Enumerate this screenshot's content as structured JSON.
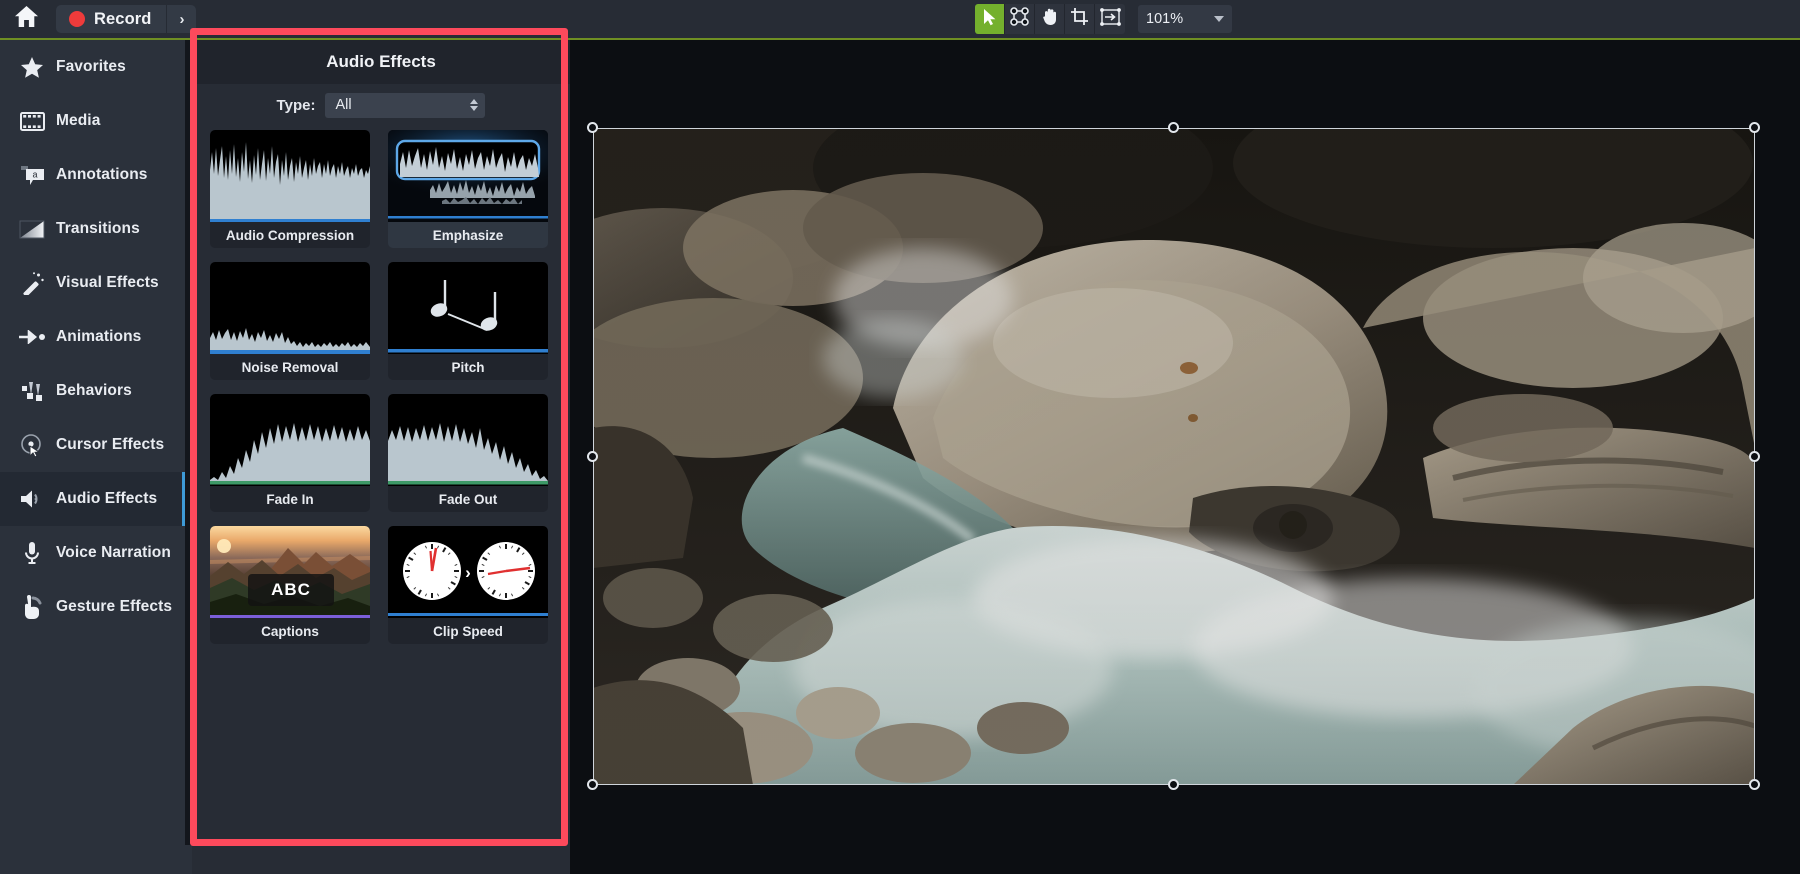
{
  "topbar": {
    "home_icon": "home-icon",
    "record_label": "Record",
    "record_dot_icon": "record-dot-icon",
    "record_more_icon": "chevron-right-icon",
    "tools": [
      {
        "name": "select-tool",
        "icon": "arrow-cursor-icon",
        "active": true
      },
      {
        "name": "node-edit-tool",
        "icon": "node-points-icon",
        "active": false
      },
      {
        "name": "hand-pan-tool",
        "icon": "hand-icon",
        "active": false
      },
      {
        "name": "crop-tool",
        "icon": "crop-icon",
        "active": false
      },
      {
        "name": "transform-tool",
        "icon": "resize-arrow-icon",
        "active": false
      }
    ],
    "zoom_value": "101%",
    "zoom_caret_icon": "chevron-down-icon"
  },
  "sidebar": {
    "items": [
      {
        "label": "Favorites",
        "icon": "star-icon",
        "active": false
      },
      {
        "label": "Media",
        "icon": "film-strip-icon",
        "active": false
      },
      {
        "label": "Annotations",
        "icon": "callout-a-icon",
        "active": false
      },
      {
        "label": "Transitions",
        "icon": "gradient-square-icon",
        "active": false
      },
      {
        "label": "Visual Effects",
        "icon": "magic-wand-icon",
        "active": false
      },
      {
        "label": "Animations",
        "icon": "arrow-motion-icon",
        "active": false
      },
      {
        "label": "Behaviors",
        "icon": "behaviors-icon",
        "active": false
      },
      {
        "label": "Cursor Effects",
        "icon": "cursor-ring-icon",
        "active": false
      },
      {
        "label": "Audio Effects",
        "icon": "speaker-icon",
        "active": true
      },
      {
        "label": "Voice Narration",
        "icon": "microphone-icon",
        "active": false
      },
      {
        "label": "Gesture Effects",
        "icon": "pointing-hand-icon",
        "active": false
      }
    ]
  },
  "panel": {
    "title": "Audio Effects",
    "filter_label": "Type:",
    "filter_value": "All",
    "filter_stepper_icon": "stepper-up-down-icon",
    "effects": [
      {
        "label": "Audio Compression",
        "thumb": "waveform-compressed",
        "accent": "#2f7fd0",
        "selected": false
      },
      {
        "label": "Emphasize",
        "thumb": "waveform-emphasized",
        "accent": "#2f7fd0",
        "selected": true
      },
      {
        "label": "Noise Removal",
        "thumb": "waveform-low-noise",
        "accent": "#2f7fd0",
        "selected": false
      },
      {
        "label": "Pitch",
        "thumb": "music-notes",
        "accent": "#2f7fd0",
        "selected": false
      },
      {
        "label": "Fade In",
        "thumb": "waveform-fade-in",
        "accent": "#3d9967",
        "selected": false
      },
      {
        "label": "Fade Out",
        "thumb": "waveform-fade-out",
        "accent": "#3d9967",
        "selected": false
      },
      {
        "label": "Captions",
        "thumb": "captions-photo",
        "accent": "#7b5fd8",
        "selected": false,
        "caption_text": "ABC"
      },
      {
        "label": "Clip Speed",
        "thumb": "two-clocks",
        "accent": "#2f7fd0",
        "selected": false,
        "separator": "›"
      }
    ]
  },
  "canvas": {
    "media_name": "river-rapids-rocks-photo",
    "handles_icon": "selection-handle-icon"
  },
  "highlight": {
    "name": "red-highlight-box",
    "color": "#fd4a5c"
  }
}
